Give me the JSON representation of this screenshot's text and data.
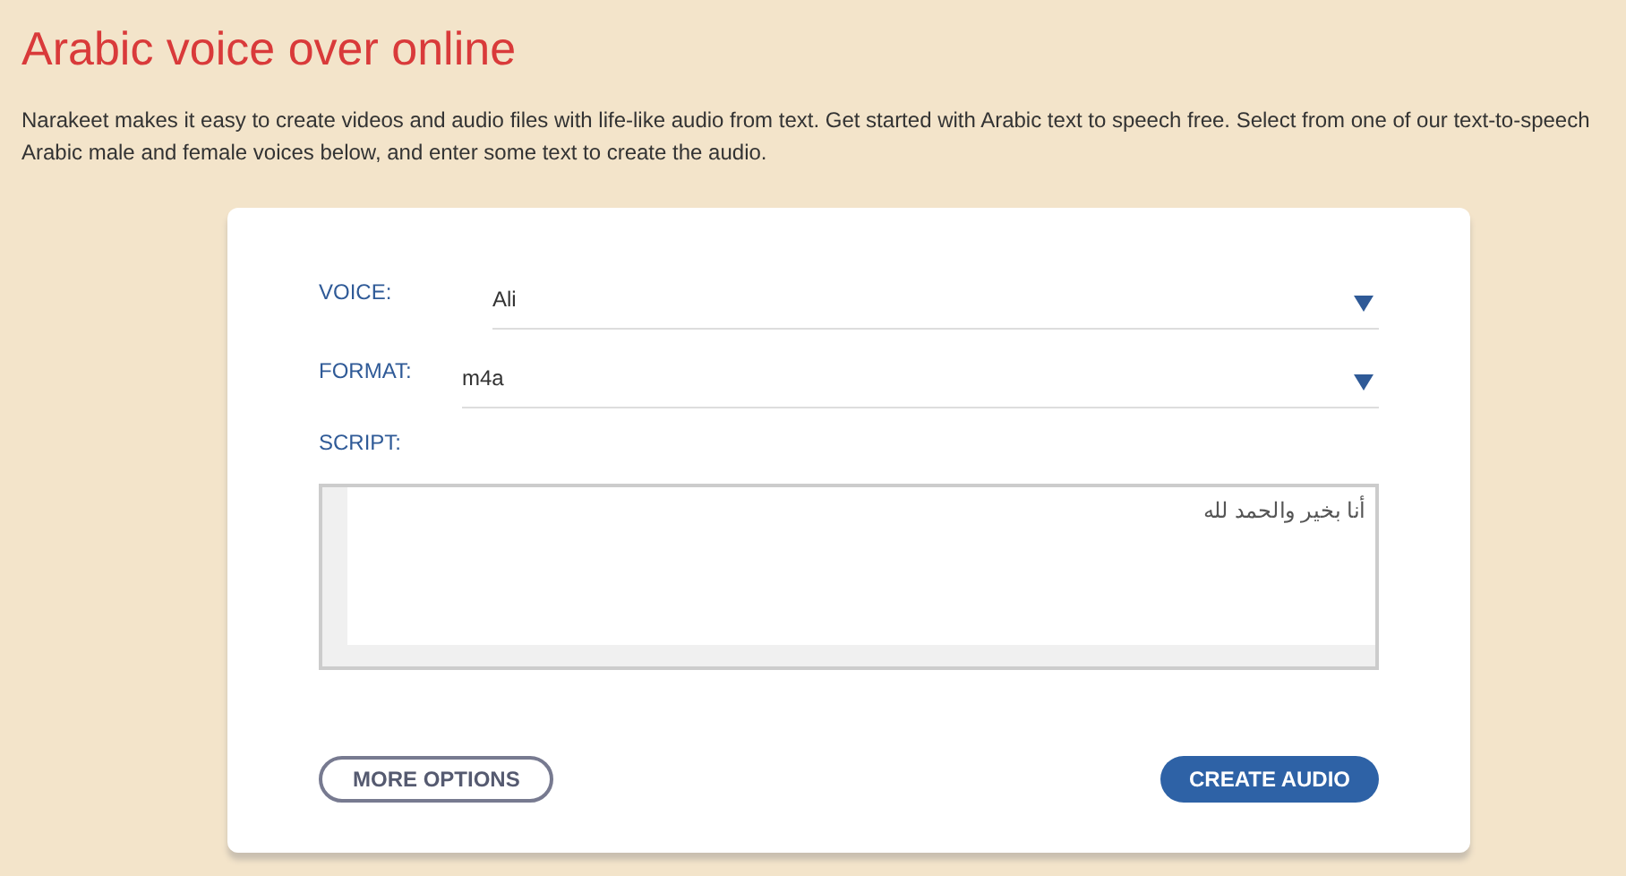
{
  "title": "Arabic voice over online",
  "intro": "Narakeet makes it easy to create videos and audio files with life-like audio from text. Get started with Arabic text to speech free. Select from one of our text-to-speech Arabic male and female voices below, and enter some text to create the audio.",
  "form": {
    "selects": [
      {
        "label": "VOICE:",
        "value": "Ali"
      },
      {
        "label": "FORMAT:",
        "value": "m4a"
      }
    ],
    "script": {
      "label": "SCRIPT:",
      "value": "أنا بخير والحمد لله"
    },
    "buttons": [
      {
        "label": "MORE OPTIONS",
        "kind": "outline"
      },
      {
        "label": "CREATE AUDIO",
        "kind": "primary"
      }
    ]
  }
}
